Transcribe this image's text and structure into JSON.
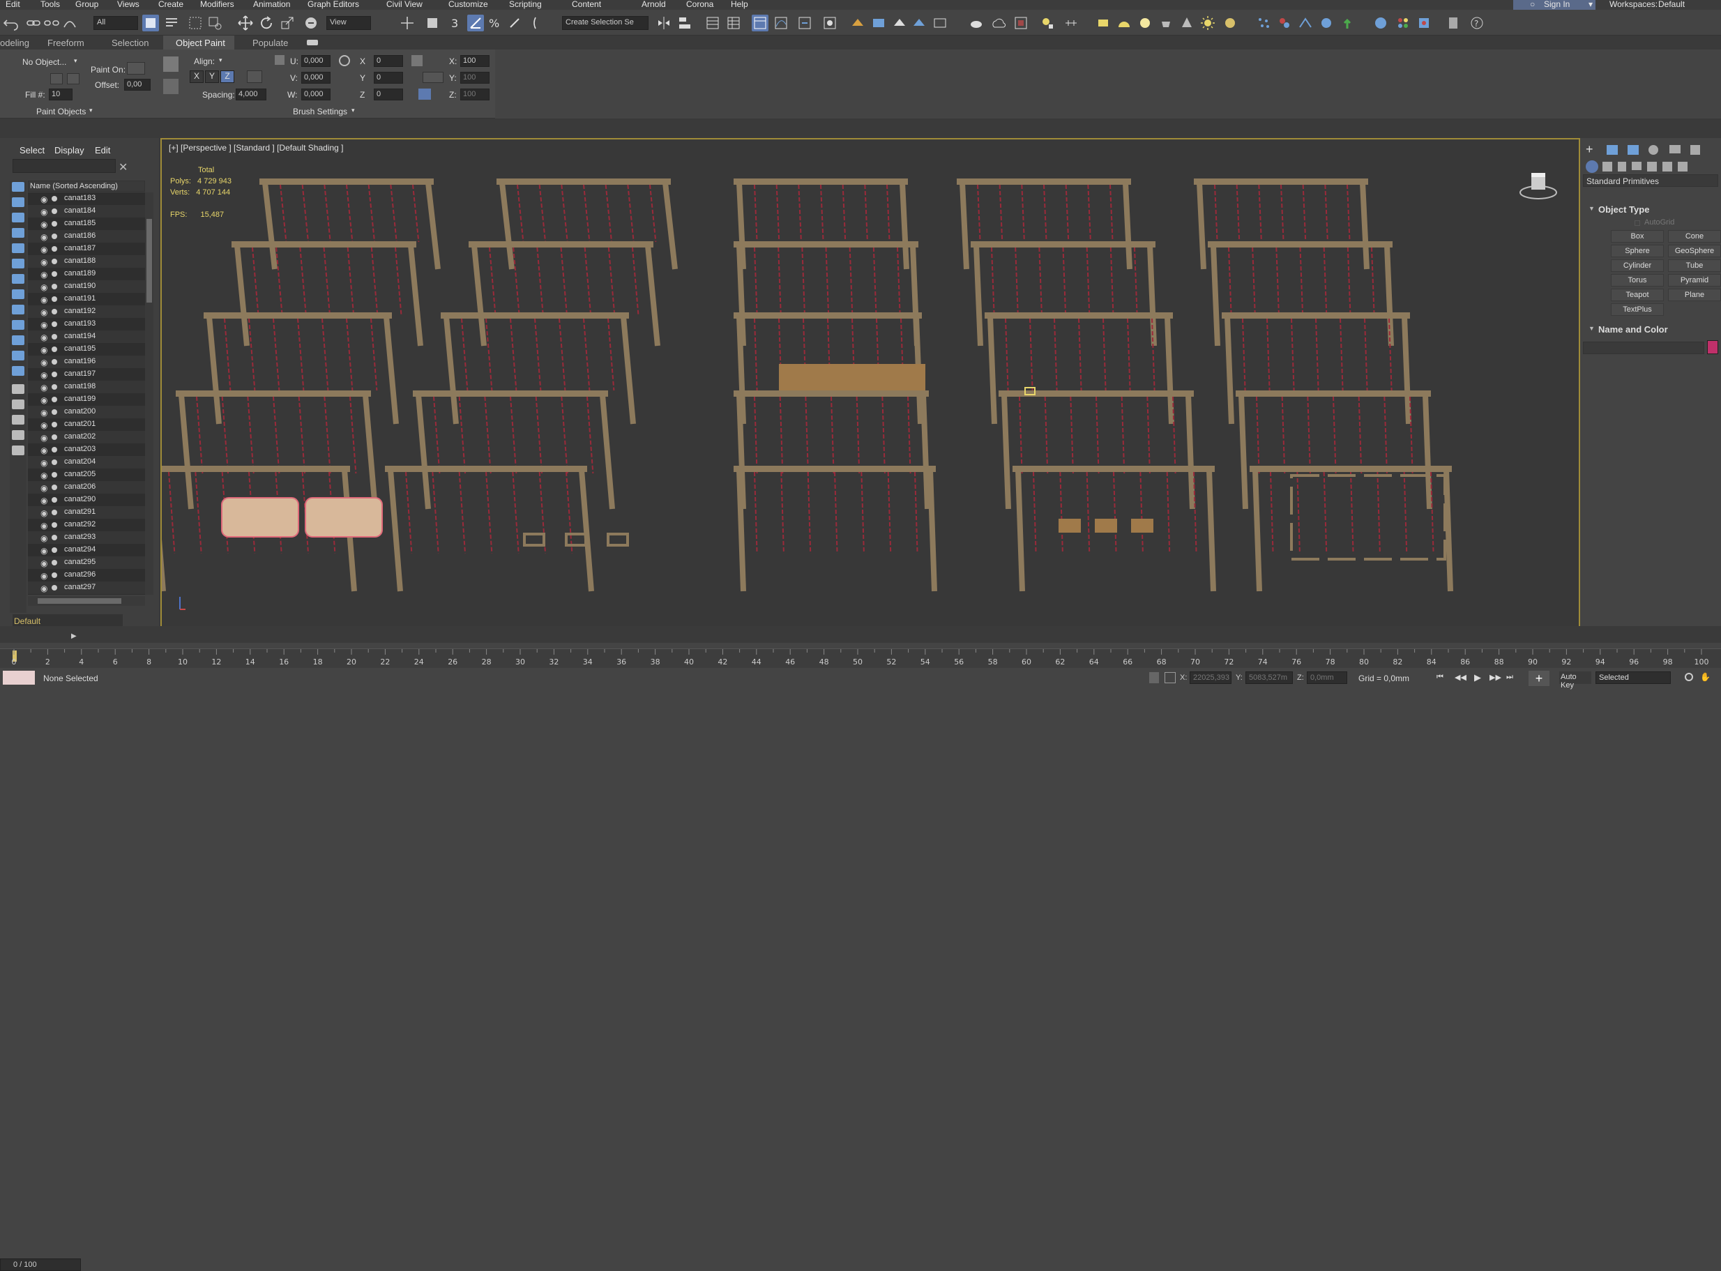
{
  "menu": [
    "Edit",
    "Tools",
    "Group",
    "Views",
    "Create",
    "Modifiers",
    "Animation",
    "Graph Editors",
    "Civil View",
    "Customize",
    "Scripting",
    "Content",
    "Arnold",
    "Corona",
    "Help"
  ],
  "account": {
    "signin": "Sign In",
    "workspaces_label": "Workspaces:",
    "workspace": "Default"
  },
  "toolbar": {
    "filter": "All",
    "refcoord": "View",
    "selset": "Create Selection Se"
  },
  "ribbon_tabs": [
    "odeling",
    "Freeform",
    "Selection",
    "Object Paint",
    "Populate"
  ],
  "ribbon": {
    "no_object": "No Object...",
    "paint_on": "Paint On:",
    "offset": "Offset:",
    "offset_val": "0,00",
    "fill": "Fill #:",
    "fill_val": "10",
    "align": "Align:",
    "axes": [
      "X",
      "Y",
      "Z"
    ],
    "spacing": "Spacing:",
    "spacing_val": "4,000",
    "u": "U:",
    "v": "V:",
    "w": "W:",
    "u_val": "0,000",
    "v_val": "0,000",
    "w_val": "0,000",
    "rx": "X",
    "ry": "Y",
    "rz": "Z",
    "rot_vals": [
      "0",
      "0",
      "0"
    ],
    "sx": "X:",
    "sy": "Y:",
    "sz": "Z:",
    "scale_vals": [
      "100",
      "100",
      "100"
    ],
    "group1": "Paint Objects",
    "group2": "Brush Settings"
  },
  "explorer": {
    "tabs": [
      "Select",
      "Display",
      "Edit"
    ],
    "header": "Name (Sorted Ascending)",
    "layer": "Default",
    "items": [
      "canat183",
      "canat184",
      "canat185",
      "canat186",
      "canat187",
      "canat188",
      "canat189",
      "canat190",
      "canat191",
      "canat192",
      "canat193",
      "canat194",
      "canat195",
      "canat196",
      "canat197",
      "canat198",
      "canat199",
      "canat200",
      "canat201",
      "canat202",
      "canat203",
      "canat204",
      "canat205",
      "canat206",
      "canat290",
      "canat291",
      "canat292",
      "canat293",
      "canat294",
      "canat295",
      "canat296",
      "canat297"
    ]
  },
  "viewport": {
    "label": "[+] [Perspective ] [Standard ] [Default Shading ]",
    "stats": {
      "total": "Total",
      "polys_label": "Polys:",
      "polys": "4 729 943",
      "verts_label": "Verts:",
      "verts": "4 707 144",
      "fps_label": "FPS:",
      "fps": "15,487"
    },
    "frames": [
      {
        "row": 0,
        "col": 0
      },
      {
        "row": 0,
        "col": 1
      },
      {
        "row": 0,
        "col": 2
      },
      {
        "row": 0,
        "col": 3
      },
      {
        "row": 0,
        "col": 4
      }
    ]
  },
  "command_panel": {
    "category": "Standard Primitives",
    "rollout1": "Object Type",
    "autogrid": "AutoGrid",
    "buttons": [
      "Box",
      "Cone",
      "Sphere",
      "GeoSphere",
      "Cylinder",
      "Tube",
      "Torus",
      "Pyramid",
      "Teapot",
      "Plane",
      "TextPlus"
    ],
    "rollout2": "Name and Color",
    "color": "#c0306a"
  },
  "time": {
    "slider": "0 / 100",
    "ticks": [
      "0",
      "2",
      "4",
      "6",
      "8",
      "10",
      "12",
      "14",
      "16",
      "18",
      "20",
      "22",
      "24",
      "26",
      "28",
      "30",
      "32",
      "34",
      "36",
      "38",
      "40",
      "42",
      "44",
      "46",
      "48",
      "50",
      "52",
      "54",
      "56",
      "58",
      "60",
      "62",
      "64",
      "66",
      "68",
      "70",
      "72",
      "74",
      "76",
      "78",
      "80",
      "82",
      "84",
      "86",
      "88",
      "90",
      "92",
      "94",
      "96",
      "98",
      "100"
    ]
  },
  "status": {
    "selected": "None Selected",
    "x_label": "X:",
    "x": "22025,393",
    "y_label": "Y:",
    "y": "5083,527m",
    "z_label": "Z:",
    "z": "0,0mm",
    "grid": "Grid = 0,0mm",
    "autokey": "Auto Key",
    "set": "Selected"
  },
  "colors": {
    "wood": "#8d7a5c",
    "rope": "#9a2a3a",
    "frame_border": "#a08c38"
  }
}
